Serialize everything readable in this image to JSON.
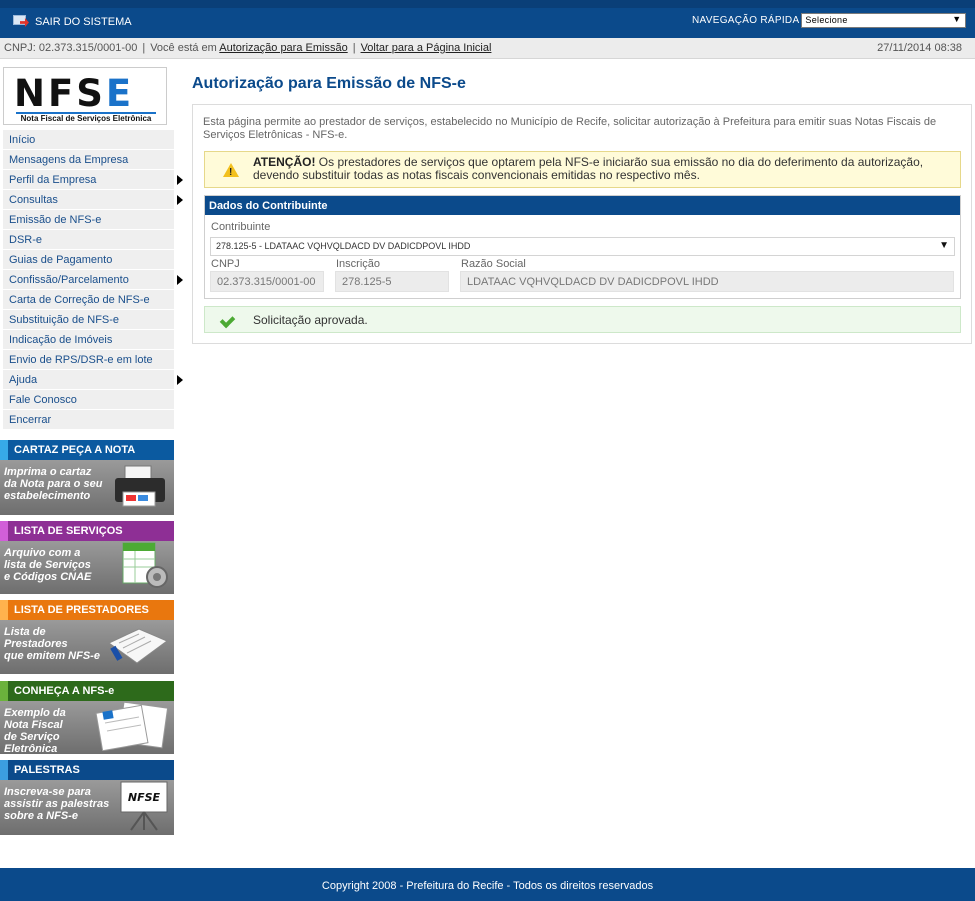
{
  "topbar": {
    "exit_label": "SAIR DO SISTEMA",
    "quicknav_label": "NAVEGAÇÃO RÁPIDA",
    "quicknav_value": "Selecione"
  },
  "breadcrumb": {
    "cnpj": "CNPJ: 02.373.315/0001-00",
    "you_are": "Você está em",
    "current": "Autorização para Emissão",
    "back": "Voltar para a Página Inicial",
    "datetime": "27/11/2014 08:38"
  },
  "logo": {
    "text_a": "NFS",
    "text_b": "E",
    "subtitle": "Nota Fiscal de Serviços Eletrônica"
  },
  "menu": [
    {
      "label": "Início"
    },
    {
      "label": "Mensagens da Empresa"
    },
    {
      "label": "Perfil da Empresa"
    },
    {
      "label": "Consultas"
    },
    {
      "label": "Emissão de NFS-e"
    },
    {
      "label": "DSR-e"
    },
    {
      "label": "Guias de Pagamento"
    },
    {
      "label": "Confissão/Parcelamento"
    },
    {
      "label": "Carta de Correção de NFS-e"
    },
    {
      "label": "Substituição de NFS-e"
    },
    {
      "label": "Indicação de Imóveis"
    },
    {
      "label": "Envio de RPS/DSR-e em lote"
    },
    {
      "label": "Ajuda"
    },
    {
      "label": "Fale Conosco"
    },
    {
      "label": "Encerrar"
    }
  ],
  "banners": {
    "cartaz": {
      "title": "CARTAZ PEÇA A NOTA",
      "l1": "Imprima o cartaz",
      "l2": "da Nota para o seu",
      "l3": "estabelecimento"
    },
    "servicos": {
      "title": "LISTA DE SERVIÇOS",
      "l1": "Arquivo com a",
      "l2": "lista de Serviços",
      "l3": "e Códigos CNAE"
    },
    "prestadores": {
      "title": "LISTA DE PRESTADORES",
      "l1": "Lista de",
      "l2": "Prestadores",
      "l3": "que emitem NFS-e"
    },
    "conheca": {
      "title": "CONHEÇA A NFS-e",
      "l1": "Exemplo da",
      "l2": "Nota Fiscal",
      "l3": "de Serviço",
      "l4": "Eletrônica"
    },
    "palestras": {
      "title": "PALESTRAS",
      "l1": "Inscreva-se para",
      "l2": "assistir as palestras",
      "l3": "sobre a NFS-e",
      "board": "NFSE"
    }
  },
  "main": {
    "title": "Autorização para Emissão de NFS-e",
    "intro": "Esta página permite ao prestador de serviços, estabelecido no Município de Recife, solicitar autorização à Prefeitura para emitir suas Notas Fiscais de Serviços Eletrônicas - NFS-e.",
    "warning_bold": "ATENÇÃO!",
    "warning_text": " Os prestadores de serviços que optarem pela NFS-e iniciarão sua emissão no dia do deferimento da autorização, devendo substituir todas as notas fiscais convencionais emitidas no respectivo mês.",
    "box_title": "Dados do Contribuinte",
    "contribuinte_label": "Contribuinte",
    "contribuinte_value": "278.125-5 - LDATAAC VQHVQLDACD DV DADICDPOVL IHDD",
    "cnpj_label": "CNPJ",
    "cnpj_value": "02.373.315/0001-00",
    "inscricao_label": "Inscrição",
    "inscricao_value": "278.125-5",
    "razao_label": "Razão Social",
    "razao_value": "LDATAAC VQHVQLDACD DV DADICDPOVL IHDD",
    "success": "Solicitação aprovada."
  },
  "footer": {
    "copyright": "Copyright 2008 - Prefeitura do Recife - Todos os direitos reservados"
  }
}
